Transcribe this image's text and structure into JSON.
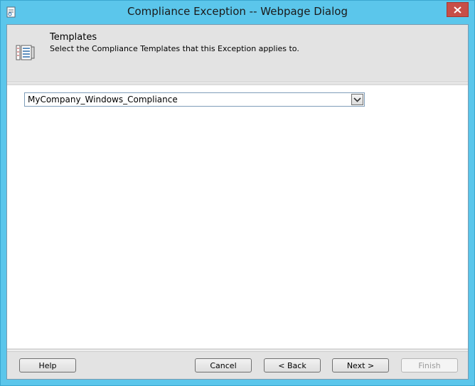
{
  "window": {
    "title": "Compliance Exception -- Webpage Dialog"
  },
  "header": {
    "title": "Templates",
    "subtitle": "Select the Compliance Templates that this Exception applies to."
  },
  "templates_select": {
    "selected_value": "MyCompany_Windows_Compliance"
  },
  "footer": {
    "help_label": "Help",
    "cancel_label": "Cancel",
    "back_label": "< Back",
    "next_label": "Next >",
    "finish_label": "Finish"
  },
  "colors": {
    "titlebar": "#5bc6eb",
    "close_button": "#c74e47",
    "panel_gray": "#e3e3e3"
  },
  "icons": {
    "app": "document-icon",
    "header": "template-list-icon",
    "close": "close-icon",
    "dropdown": "chevron-down-icon"
  }
}
